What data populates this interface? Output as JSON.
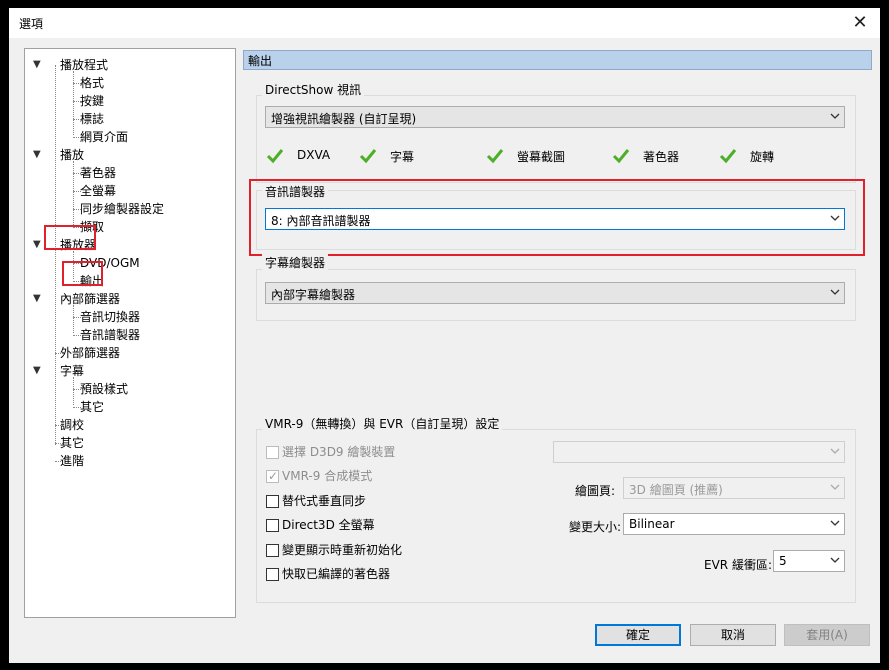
{
  "window": {
    "title": "選項",
    "close_icon": "close-icon"
  },
  "tree": {
    "items": [
      {
        "label": "播放程式",
        "expanded": true
      },
      {
        "label": "格式"
      },
      {
        "label": "按鍵"
      },
      {
        "label": "標誌"
      },
      {
        "label": "網頁介面"
      },
      {
        "label": "播放",
        "expanded": true
      },
      {
        "label": "著色器"
      },
      {
        "label": "全螢幕"
      },
      {
        "label": "同步繪製器設定"
      },
      {
        "label": "擷取"
      },
      {
        "label": "播放器",
        "expanded": true
      },
      {
        "label": "DVD/OGM"
      },
      {
        "label": "輸出",
        "selected": true
      },
      {
        "label": "內部篩選器",
        "expanded": true
      },
      {
        "label": "音訊切換器"
      },
      {
        "label": "音訊譜製器"
      },
      {
        "label": "外部篩選器"
      },
      {
        "label": "字幕",
        "expanded": true
      },
      {
        "label": "預設樣式"
      },
      {
        "label": "其它"
      },
      {
        "label": "調校"
      },
      {
        "label": "其它"
      },
      {
        "label": "進階"
      }
    ]
  },
  "pane": {
    "title": "輸出",
    "directshow": {
      "group_title": "DirectShow 視訊",
      "renderer": "增強視訊繪製器 (自訂呈現)",
      "features": [
        {
          "label": "DXVA",
          "supported": true
        },
        {
          "label": "字幕",
          "supported": true
        },
        {
          "label": "螢幕截圖",
          "supported": true
        },
        {
          "label": "著色器",
          "supported": true
        },
        {
          "label": "旋轉",
          "supported": true
        }
      ]
    },
    "audio": {
      "group_title": "音訊譜製器",
      "renderer": "8: 內部音訊譜製器"
    },
    "subtitle": {
      "group_title": "字幕繪製器",
      "renderer": "內部字幕繪製器"
    },
    "vmr": {
      "group_title": "VMR-9（無轉換）與 EVR（自訂呈現）設定",
      "options": [
        {
          "label": "選擇 D3D9 繪製裝置",
          "checked": false,
          "enabled": false
        },
        {
          "label": "VMR-9 合成模式",
          "checked": true,
          "enabled": false
        },
        {
          "label": "替代式垂直同步",
          "checked": false,
          "enabled": true
        },
        {
          "label": "Direct3D 全螢幕",
          "checked": false,
          "enabled": true
        },
        {
          "label": "變更顯示時重新初始化",
          "checked": false,
          "enabled": true
        },
        {
          "label": "快取已編譯的著色器",
          "checked": false,
          "enabled": true
        }
      ],
      "d3d9_device": "",
      "surface_label": "繪圖頁:",
      "surface_value": "3D 繪圖頁 (推薦)",
      "resize_label": "變更大小:",
      "resize_value": "Bilinear",
      "evr_label": "EVR 緩衝區:",
      "evr_value": "5"
    }
  },
  "buttons": {
    "ok": "確定",
    "cancel": "取消",
    "apply": "套用(A)"
  },
  "colors": {
    "highlight_red": "#e0202a",
    "focus_blue": "#0078d7",
    "check_green": "#4caf27",
    "header_blue": "#b9d1ea"
  }
}
